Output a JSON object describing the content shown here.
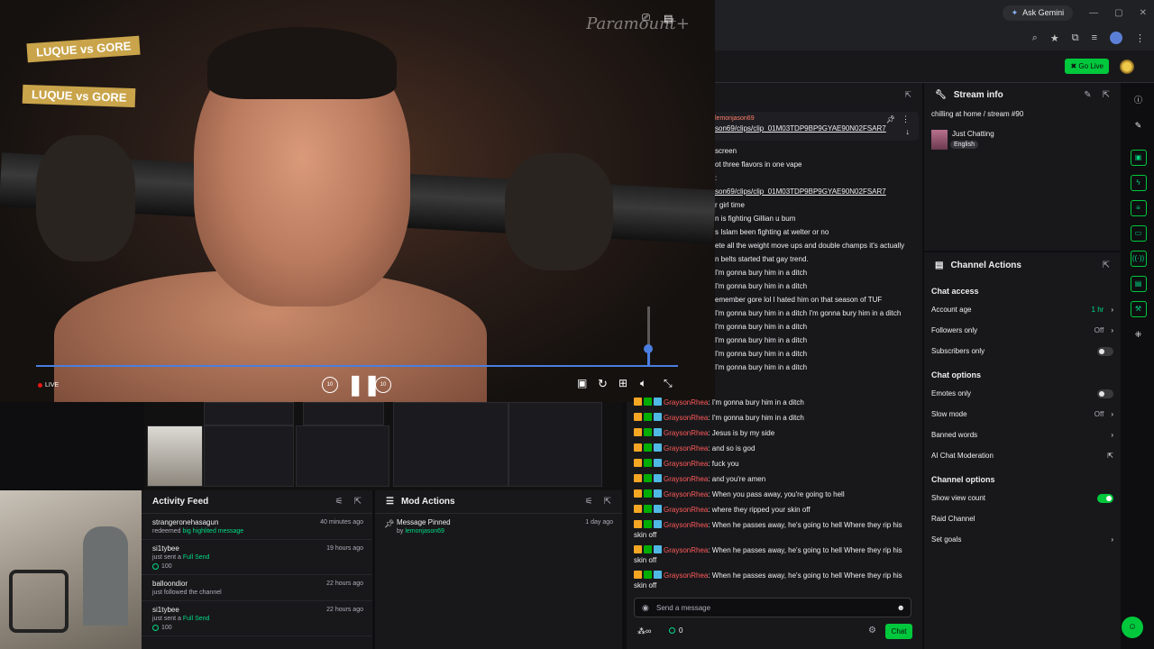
{
  "browser": {
    "gemini_label": "Ask Gemini",
    "win_min": "—",
    "win_max": "▢",
    "win_close": "✕"
  },
  "twitch": {
    "go_live": "Go Live"
  },
  "video": {
    "watermark": "Paramount+",
    "live_label": "LIVE",
    "banner1": "LUQUE vs GORE",
    "banner2": "LUQUE vs GORE",
    "rewind_label": "10",
    "forward_label": "10",
    "volume_level": 0.3
  },
  "activity_feed": {
    "title": "Activity Feed",
    "items": [
      {
        "name": "strangeronehasagun",
        "time": "40 minutes ago",
        "sub_prefix": "redeemed ",
        "sub_highlight": "big highlited message",
        "amount": ""
      },
      {
        "name": "si1tybee",
        "time": "19 hours ago",
        "sub_prefix": "just sent a ",
        "sub_highlight": "Full Send",
        "amount": "100"
      },
      {
        "name": "balloondior",
        "time": "22 hours ago",
        "sub_prefix": "just followed the channel",
        "sub_highlight": "",
        "amount": ""
      },
      {
        "name": "si1tybee",
        "time": "22 hours ago",
        "sub_prefix": "just sent a ",
        "sub_highlight": "Full Send",
        "amount": "100"
      }
    ]
  },
  "mod_actions": {
    "title": "Mod Actions",
    "items": [
      {
        "title": "Message Pinned",
        "time": "1 day ago",
        "by_prefix": "by ",
        "by_user": "lemonjason69"
      }
    ]
  },
  "chat": {
    "pinned_user": "lemonjason69",
    "pinned_link": "son69/clips/clip_01M03TDP9BP9GYAE90N02FSAR7",
    "upper_lines": [
      {
        "text": "screen"
      },
      {
        "text": "ot three flavors in one vape"
      },
      {
        "text": ":"
      },
      {
        "text": "son69/clips/clip_01M03TDP9BP9GYAE90N02FSAR7",
        "link": true
      },
      {
        "text": "r girl time"
      },
      {
        "text": "n is fighting Gillian u bum"
      },
      {
        "text": "s Islam been fighting at welter or no"
      },
      {
        "text": "ete all the weight move ups and double champs it's actually"
      },
      {
        "text": "n belts started that gay trend."
      },
      {
        "text": "I'm gonna bury him in a ditch"
      },
      {
        "text": "I'm gonna bury him in a ditch"
      },
      {
        "text": "emember gore lol I hated him on that season of TUF"
      },
      {
        "text": "I'm gonna bury him in a ditch I'm gonna bury him in a ditch"
      },
      {
        "text": "I'm gonna bury him in a ditch"
      },
      {
        "text": "I'm gonna bury him in a ditch"
      },
      {
        "text": "I'm gonna bury him in a ditch"
      },
      {
        "text": "I'm gonna bury him in a ditch"
      }
    ],
    "user": "GraysonRhea",
    "lower_lines": [
      ": I'm gonna bury him in a ditch",
      ": I'm gonna bury him in a ditch",
      ": Jesus is by my side",
      ": and so is god",
      ": fuck you",
      ": and you're amen",
      ": When you pass away, you're going to hell",
      ": where they ripped your skin off",
      ": When he passes away, he's going to hell Where they rip his skin off",
      ": When he passes away, he's going to hell Where they rip his skin off",
      ": When he passes away, he's going to hell Where they rip his skin off"
    ],
    "input_placeholder": "Send a message",
    "points": "0",
    "chat_button": "Chat"
  },
  "stream_info": {
    "title": "Stream info",
    "stream_title": "chilling at home / stream #90",
    "category": "Just Chatting",
    "language": "English"
  },
  "channel_actions": {
    "title": "Channel Actions",
    "chat_access": "Chat access",
    "account_age": "Account age",
    "account_age_value": "1 hr",
    "followers_only": "Followers only",
    "followers_only_value": "Off",
    "subscribers_only": "Subscribers only",
    "chat_options": "Chat options",
    "emotes_only": "Emotes only",
    "slow_mode": "Slow mode",
    "slow_mode_value": "Off",
    "banned_words": "Banned words",
    "ai_moderation": "AI Chat Moderation",
    "channel_options": "Channel options",
    "show_view_count": "Show view count",
    "raid_channel": "Raid Channel",
    "set_goals": "Set goals"
  }
}
